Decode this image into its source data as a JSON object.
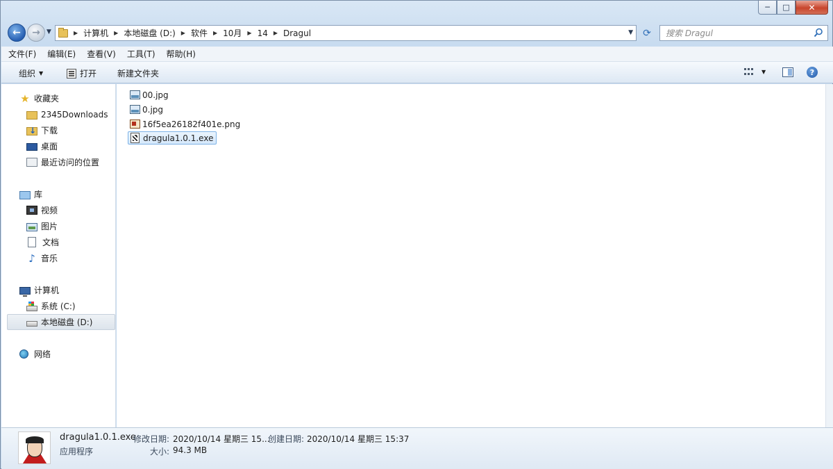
{
  "window": {
    "caption": {
      "minimize": "─",
      "maximize": "□",
      "close": "✕"
    }
  },
  "address": {
    "crumbs": [
      "计算机",
      "本地磁盘 (D:)",
      "软件",
      "10月",
      "14",
      "Dragul"
    ],
    "search_placeholder": "搜索 Dragul"
  },
  "menu": [
    "文件(F)",
    "编辑(E)",
    "查看(V)",
    "工具(T)",
    "帮助(H)"
  ],
  "toolbar": {
    "organize": "组织",
    "open": "打开",
    "new_folder": "新建文件夹",
    "help": "?"
  },
  "nav": {
    "favorites": {
      "label": "收藏夹",
      "items": [
        "2345Downloads",
        "下载",
        "桌面",
        "最近访问的位置"
      ]
    },
    "libraries": {
      "label": "库",
      "items": [
        "视频",
        "图片",
        "文档",
        "音乐"
      ]
    },
    "computer": {
      "label": "计算机",
      "items": [
        "系统 (C:)",
        "本地磁盘 (D:)"
      ],
      "selected": "本地磁盘 (D:)"
    },
    "network": {
      "label": "网络"
    }
  },
  "files": [
    {
      "name": "00.jpg",
      "icon": "jpg-icon"
    },
    {
      "name": "0.jpg",
      "icon": "jpg-icon"
    },
    {
      "name": "16f5ea26182f401e.png",
      "icon": "png-icon"
    },
    {
      "name": "dragula1.0.1.exe",
      "icon": "exe-icon",
      "selected": true
    }
  ],
  "details": {
    "name": "dragula1.0.1.exe",
    "type": "应用程序",
    "modified_label": "修改日期:",
    "modified_value": "2020/10/14 星期三 15...",
    "created_label": "创建日期:",
    "created_value": "2020/10/14 星期三 15:37",
    "size_label": "大小:",
    "size_value": "94.3 MB"
  },
  "colors": {
    "accent": "#2760b3",
    "selection": "#d5e8fb",
    "close": "#c8452c"
  }
}
